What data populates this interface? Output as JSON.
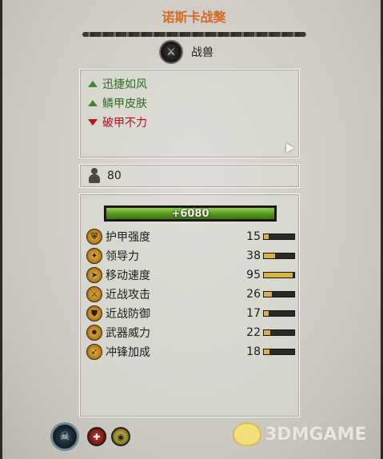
{
  "unit": {
    "name": "诺斯卡战獒",
    "class_label": "战兽",
    "class_icon_glyph": "⚔"
  },
  "traits": [
    {
      "label": "迅捷如风",
      "kind": "positive"
    },
    {
      "label": "鳞甲皮肤",
      "kind": "positive"
    },
    {
      "label": "破甲不力",
      "kind": "negative"
    }
  ],
  "upkeep": {
    "value": "80"
  },
  "health": {
    "label": "+6080",
    "fill_fraction": 1.0
  },
  "stats": [
    {
      "name": "护甲强度",
      "value": "15",
      "icon": "armor-icon",
      "glyph": "⛨",
      "fill": 0.15
    },
    {
      "name": "领导力",
      "value": "38",
      "icon": "leadership-icon",
      "glyph": "✦",
      "fill": 0.38
    },
    {
      "name": "移动速度",
      "value": "95",
      "icon": "speed-icon",
      "glyph": "➤",
      "fill": 0.95
    },
    {
      "name": "近战攻击",
      "value": "26",
      "icon": "melee-attack-icon",
      "glyph": "⚔",
      "fill": 0.26
    },
    {
      "name": "近战防御",
      "value": "17",
      "icon": "melee-defence-icon",
      "glyph": "⛊",
      "fill": 0.17
    },
    {
      "name": "武器威力",
      "value": "22",
      "icon": "weapon-strength-icon",
      "glyph": "✸",
      "fill": 0.22
    },
    {
      "name": "冲锋加成",
      "value": "18",
      "icon": "charge-bonus-icon",
      "glyph": "➶",
      "fill": 0.18
    }
  ],
  "bottom": {
    "faction_glyph": "☠",
    "ability1_glyph": "✚",
    "ability2_glyph": "◉"
  },
  "watermark": {
    "text": "3DMGAME"
  },
  "colors": {
    "title": "#d8691f",
    "positive": "#2f6d20",
    "negative": "#b0151b",
    "health": "#6cb530"
  }
}
